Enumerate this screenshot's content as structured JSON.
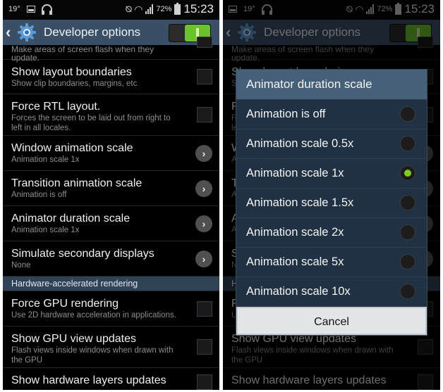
{
  "status_bar": {
    "left": {
      "temperature": "19°"
    },
    "right": {
      "battery_percent": "72%",
      "time": "15:23"
    }
  },
  "action_bar": {
    "title": "Developer options",
    "master_toggle": "on"
  },
  "settings": {
    "partial_top_subtitle": "Make areas of screen flash when they update.",
    "items": [
      {
        "title": "Show layout boundaries",
        "subtitle": "Show clip boundaries, margins, etc",
        "control": "checkbox",
        "checked": false
      },
      {
        "title": "Force RTL layout.",
        "subtitle": "Forces the screen to be laid out from right to left in all locales.",
        "control": "checkbox",
        "checked": false
      },
      {
        "title": "Window animation scale",
        "subtitle": "Animation scale 1x",
        "control": "chevron"
      },
      {
        "title": "Transition animation scale",
        "subtitle": "Animation is off",
        "control": "chevron"
      },
      {
        "title": "Animator duration scale",
        "subtitle": "Animation scale 1x",
        "control": "chevron"
      },
      {
        "title": "Simulate secondary displays",
        "subtitle": "None",
        "control": "chevron"
      }
    ],
    "section_header": "Hardware-accelerated rendering",
    "hw_items": [
      {
        "title": "Force GPU rendering",
        "subtitle": "Use 2D hardware acceleration in applications.",
        "control": "checkbox",
        "checked": false
      },
      {
        "title": "Show GPU view updates",
        "subtitle": "Flash views inside windows when drawn with the GPU",
        "control": "checkbox",
        "checked": false
      },
      {
        "title": "Show hardware layers updates",
        "subtitle": "",
        "control": "checkbox",
        "checked": false
      }
    ]
  },
  "dialog": {
    "title": "Animator duration scale",
    "options": [
      {
        "label": "Animation is off",
        "selected": false
      },
      {
        "label": "Animation scale 0.5x",
        "selected": false
      },
      {
        "label": "Animation scale 1x",
        "selected": true
      },
      {
        "label": "Animation scale 1.5x",
        "selected": false
      },
      {
        "label": "Animation scale 2x",
        "selected": false
      },
      {
        "label": "Animation scale 5x",
        "selected": false
      },
      {
        "label": "Animation scale 10x",
        "selected": false
      }
    ],
    "cancel_label": "Cancel"
  },
  "colors": {
    "accent_green": "#6cc22a",
    "action_bar": "#3a4f66",
    "dialog_title": "#456078",
    "radio_selected": "#7ecb22"
  }
}
